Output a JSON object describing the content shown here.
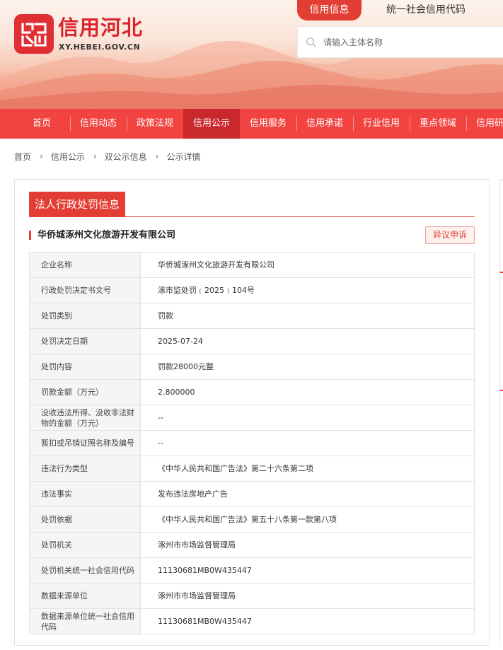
{
  "site": {
    "title": "信用河北",
    "domain": "XY.HEBEI.GOV.CN"
  },
  "search": {
    "tabs": [
      {
        "label": "信用信息",
        "active": true
      },
      {
        "label": "统一社会信用代码",
        "active": false
      }
    ],
    "placeholder": "请输入主体名称",
    "value": ""
  },
  "nav": {
    "items": [
      {
        "label": "首页",
        "active": false
      },
      {
        "label": "信用动态",
        "active": false
      },
      {
        "label": "政策法规",
        "active": false
      },
      {
        "label": "信用公示",
        "active": true
      },
      {
        "label": "信用服务",
        "active": false
      },
      {
        "label": "信用承诺",
        "active": false
      },
      {
        "label": "行业信用",
        "active": false
      },
      {
        "label": "重点领域",
        "active": false
      },
      {
        "label": "信用研究",
        "active": false
      }
    ]
  },
  "breadcrumb": [
    "首页",
    "信用公示",
    "双公示信息",
    "公示详情"
  ],
  "card": {
    "title": "法人行政处罚信息",
    "company": "华侨城涿州文化旅游开发有限公司",
    "appeal_label": "异议申诉"
  },
  "details": [
    {
      "label": "企业名称",
      "value": "华侨城涿州文化旅游开发有限公司"
    },
    {
      "label": "行政处罚决定书文号",
      "value": "涿市监处罚﹝2025﹞104号"
    },
    {
      "label": "处罚类别",
      "value": "罚款"
    },
    {
      "label": "处罚决定日期",
      "value": "2025-07-24"
    },
    {
      "label": "处罚内容",
      "value": "罚款28000元整"
    },
    {
      "label": "罚款金额（万元）",
      "value": "2.800000"
    },
    {
      "label": "没收违法所得、没收非法财物的金额（万元）",
      "value": "--"
    },
    {
      "label": "暂扣或吊销证照名称及编号",
      "value": "--"
    },
    {
      "label": "违法行为类型",
      "value": "《中华人民共和国广告法》第二十六条第二项"
    },
    {
      "label": "违法事实",
      "value": "发布违法房地产广告"
    },
    {
      "label": "处罚依据",
      "value": "《中华人民共和国广告法》第五十八条第一款第八项"
    },
    {
      "label": "处罚机关",
      "value": "涿州市市场监督管理局"
    },
    {
      "label": "处罚机关统一社会信用代码",
      "value": "11130681MB0W435447"
    },
    {
      "label": "数据来源单位",
      "value": "涿州市市场监督管理局"
    },
    {
      "label": "数据来源单位统一社会信用代码",
      "value": "11130681MB0W435447"
    }
  ],
  "colors": {
    "brand_red": "#e33e34",
    "nav_red": "#f1433f",
    "nav_active": "#c9282c"
  }
}
